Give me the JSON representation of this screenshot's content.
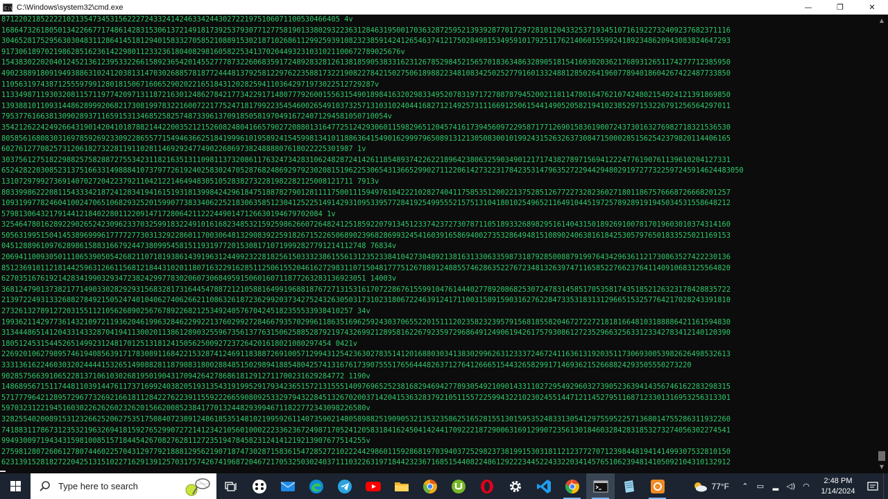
{
  "window": {
    "title": "C:\\Windows\\system32\\cmd.exe",
    "icon_name": "cmd-app-icon",
    "controls": [
      "—",
      "❐",
      "✕"
    ]
  },
  "console": {
    "text_color": "#2fc96a",
    "lines": [
      "871220218522221021354734531562227243324142463342443027221975106071100530466405 4v",
      "168647326180501342266771748614283153061372149181739253793077127758190133802932236312846319500170363287259521393928770172972810120433253719345107161922732409237682371116",
      "304652817529563030483112864145181294015833270585210889153021871026861129925939108232385914241265463741217502849815349591017925117621406015599241892348620943083824647293",
      "91730618970219862851623614229801123323618040829816058225341370204493231031021100672789025676v",
      "154383022020401245213612395332266158923654201455277787322606835917248928328126138185905383316231267852984521565701836348632890518154160302036217689312651174277712385950",
      "490238891809194938863102412038131470302688578187724448137925812297622358817322190822784215027506189882234810834250252779160133248812850264196077894018604267422487733850",
      "11056319743871255597991280181506716065290202216518431202825941103642971973022512729287v",
      "113349871193032081157119774209713118721630124862784217734229171480777926001556315490189841632029833495207831971727887879452002118114780164762107424802154924121391869850",
      "139388101109314486289992068217308199783221600722177524718179922354546002654910373257131031024044168271214925731116691250615441490520582194102385297153226791256564297011",
      "79537761663813090289371165915313468525825748733961370918505819704916724071294581050710054v",
      "354212622424926643190142041018788214422003521215260824804166579027208801316477251242930601159829651204574161739456097229587177126901583619007243730163276982718321536530",
      "805856168083031697859269233092286557715494636625184199961019589241545998134101188636415490162999796508913121305083001019924315263263730847150002851562542379820114406165",
      "602761277082573120618273228119110281146929247749022686973824888807618022225301987 1v",
      "303756127518229882575828872755342311821635131109811373208611763247342831062482872414261185489374226221896423806325903490121717438278971569412224776190761139610204127331",
      "652428220308523137516633149888410737977261924025830247052876824869297923020815196225306543136652990271122061427322317842353147963527229442948029197277322597245914624483050",
      "131072979927369140702720422379211042122146494830510528382732281982282125008121711 7913v",
      "803399862220811543334218724128341941615193181399842429618475188782790128111175001115949761042221028274041175853512002213752851267722732823602718011867576668726668201257",
      "109319977824604100247065106829325201599077383340622521830635851230412522514914293109533957728419254995552157513104180102549652116491044519725789289191945034531558648212",
      "57981306432179144121840228011220914717280642112224490147126630194679702084 1v",
      "325464780162892290265242309623370325991832249101616823485321592598626607264824125185922079134512337423727307871105189332689829516140431501892691007817019603010374314160",
      "505631995150414538969996177772773031329228601170030648132908392259182671522650689023968286993245416039165869400273532864948151089024063816184253057976501833525021169153",
      "045128896109762898615883166792447380995458151193197720153081710719992827791214112748 76834v",
      "206941100930501110653905054268211071819386143919631244992322818256150333238615561312352338410427304892138163133063359873187928500887919976434296361121730863527422230136",
      "851236910112181442596312661156812184431020118071632291628511250615520461627298311071504817775126788912488557462863522767234813263974711658522766237641140910683125564820",
      "627035167619214283419903293472382429977830206073068495915060160711877263283136923051 14003v",
      "368124790137382177149033028292931568328173164454788721210588164991968818767271315316170722867615599104761444027789208682530724783145851705358174351852126323178428835722",
      "213972249313326882784921505247401040627406266211086326187236299203734275243263050317310231806722463912417110031589159031627622847335318313129665153257764217028243391810",
      "273261327891272031551121056268902567678922682125349240576704245182355533938410257 34v",
      "199362114297736143210972119362046199632846229922137602992728466793570299611863516962592430370655220151112023582323957915681855820467272272181816648103188886421161594830",
      "313444865141204331433287041941130020113861289032559673561377631506258852879219743269921289581622679235972968649124906194261757930861272352966325633123342783412140120390",
      "1805124531544526514992312481701251318124150562500927237264201618021080297454 0421v",
      "226920106279895746194085639171783089116842215328741246911838872691005712994312542363027835141201688030341383029962631233372467241163613192035117306930053982626498532613",
      "333136162246030320244441532651490882811879083180028848515029894188548042574131676173907555176564448263712764126665154432658299171469362152668824293505550273220",
      "9028575663910652281371061030268195019043170942642786861812912711700231629284772 1190v",
      "148689567151174481103914476117371699240382051931354319199529179342365157213155514097696525238168294694277893054921090143311027295492960327390523639414356746162283298315",
      "571777964212895729677326921661811284227622391155922266590809253329794322845132670200371420415363283792105115572259943221023024551447121145279511687123301316953256313301",
      "597032312219451603022626260232620156620085238417701324482939946711822772343098226580v",
      "328255402008915312326625206275351750840723891248618535148102199592611407359021480589882519090532135323586251652815513015953524833130541297559522571368014755286311932260",
      "741883117867312353219632694181592765299072721412342105601000222336236724987170524120583184162450414244170922218729006316912990723561301846032842831853273274056302274541",
      "994930097194343159810085157184454267082762811272351947845823124141219213907677514255v",
      "275981280726061278074460225704312977921888129562190718747302871583615472852721022244298601159286819703940372529823738199153031811212377270712398448194141499307532810150",
      "623139152818272204251315102271629139125703175742674196872046721705325030240371110322631971844232367168515440822486129222344522433220341457651062394814105092104310132912",
      "5418435324940579100243881361814527721111558187359448243732894715766175122120 6v"
    ]
  },
  "taskbar": {
    "search_placeholder": "Type here to search",
    "apps": [
      "task-view-icon",
      "media-player-icon",
      "mail-icon",
      "edge-icon",
      "telegram-icon",
      "youtube-icon",
      "file-explorer-icon",
      "chrome-canary-icon",
      "utorrent-icon",
      "opera-icon",
      "settings-icon",
      "vscode-icon",
      "chrome-icon",
      "terminal-icon",
      "notepad-icon",
      "app-icon"
    ],
    "weather": "77°F",
    "clock_time": "2:48 PM",
    "clock_date": "1/14/2024"
  }
}
